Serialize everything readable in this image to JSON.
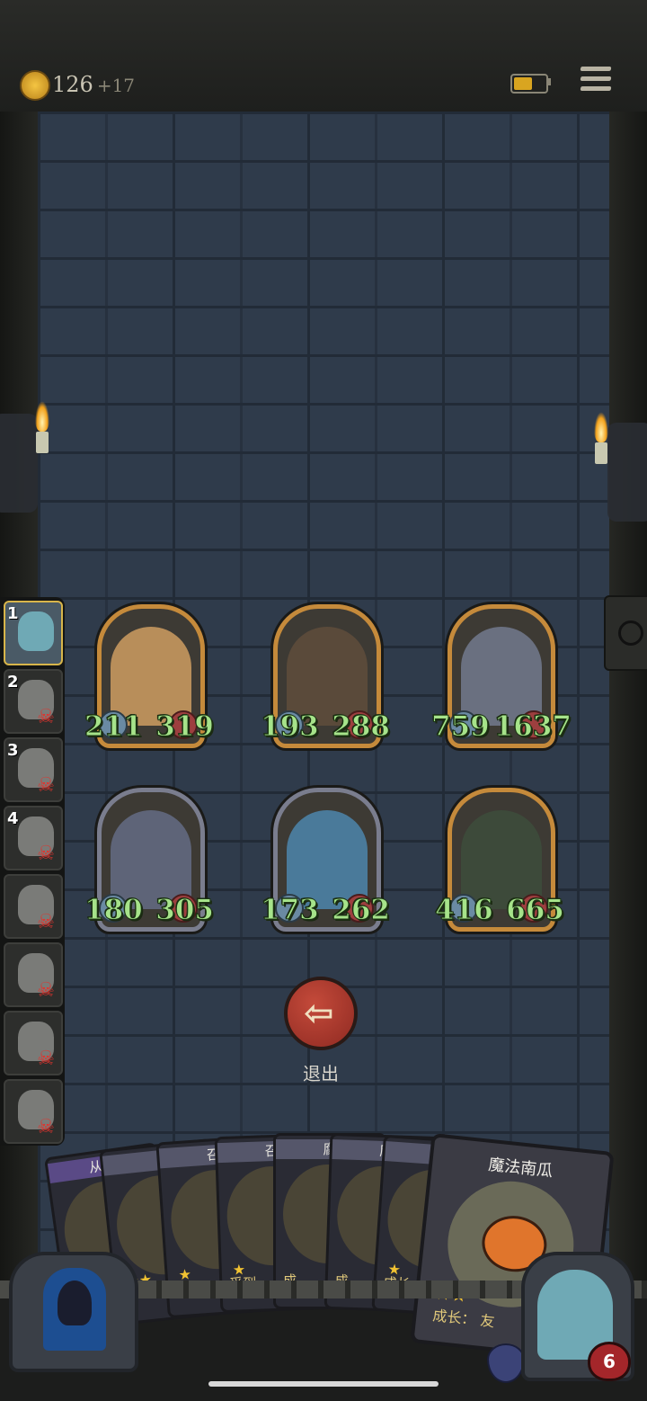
{
  "topbar": {
    "coins": "126",
    "coin_delta": "+17"
  },
  "enemies": [
    {
      "atk": "211",
      "hp": "319",
      "frame": "gold",
      "color": "#b88e5a"
    },
    {
      "atk": "193",
      "hp": "288",
      "frame": "gold",
      "color": "#5a4a3a"
    },
    {
      "atk": "759",
      "hp": "1637",
      "frame": "gold",
      "color": "#6a7080"
    },
    {
      "atk": "180",
      "hp": "305",
      "frame": "silver",
      "color": "#5e6478"
    },
    {
      "atk": "173",
      "hp": "262",
      "frame": "silver",
      "color": "#4a7a9a"
    },
    {
      "atk": "416",
      "hp": "665",
      "frame": "gold",
      "color": "#3d4a3a"
    }
  ],
  "party": [
    {
      "num": "1",
      "active": true
    },
    {
      "num": "2",
      "dead": true
    },
    {
      "num": "3",
      "dead": true
    },
    {
      "num": "4",
      "dead": true
    },
    {
      "num": "",
      "dead": true
    },
    {
      "num": "",
      "dead": true
    },
    {
      "num": "",
      "dead": true
    },
    {
      "num": "",
      "dead": true
    }
  ],
  "exit": {
    "label": "退出"
  },
  "hand": {
    "cards": [
      {
        "title": "从零",
        "text": "以",
        "purple": true
      },
      {
        "title": "",
        "text": "",
        "stars": "★★"
      },
      {
        "title": "召",
        "text": "友方",
        "stars": "★"
      },
      {
        "title": "召",
        "text": "受到",
        "stars": "★"
      },
      {
        "title": "腐",
        "text": "成",
        "stars": ""
      },
      {
        "title": "腐",
        "text": "成",
        "stars": ""
      },
      {
        "title": "腐",
        "text": "成长",
        "stars": "★"
      }
    ],
    "front": {
      "title": "魔法南瓜",
      "stars": "★★",
      "text": "成长：",
      "extra": "友"
    }
  },
  "hero": {
    "life": "6"
  }
}
